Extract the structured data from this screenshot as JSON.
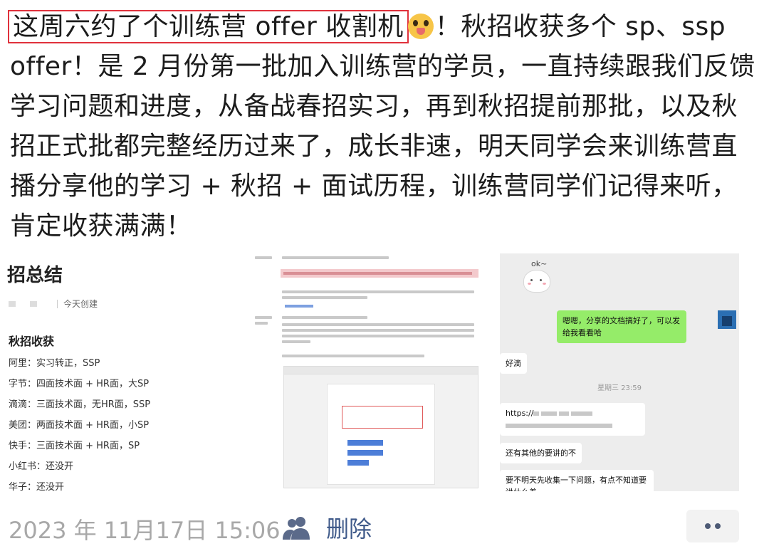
{
  "post": {
    "highlight": "这周六约了个训练营 offer 收割机",
    "text": "！秋招收获多个 sp、ssp offer！是 2 月份第一批加入训练营的学员，一直持续跟我们反馈学习问题和进度，从备战春招实习，再到秋招提前那批，以及秋招正式批都完整经历过来了，成长非速，明天同学会来训练营直播分享他的学习 + 秋招 + 面试历程，训练营同学们记得来听，肯定收获满满！",
    "emoji": "face-with-tongue-emoji"
  },
  "summary": {
    "title": "招总结",
    "created": "今天创建",
    "section": "秋招收获",
    "items": [
      "阿里：实习转正，SSP",
      "字节：四面技术面 + HR面，大SP",
      "滴滴：三面技术面，无HR面，SSP",
      "美团：两面技术面 + HR面，小SP",
      "快手：三面技术面 + HR面，SP",
      "小红书：还没开",
      "华子：还没开"
    ]
  },
  "chat": {
    "sticker_text": "ok~",
    "msg_me": "嗯嗯，分享的文档搞好了，可以发给我看看哈",
    "msg_1": "好滴",
    "time": "星期三 23:59",
    "link_prefix": "https://",
    "msg_2": "还有其他的要讲的不",
    "msg_3": "要不明天先收集一下问题，有点不知道要讲什么着"
  },
  "footer": {
    "date": "2023 年 11月17日 15:06",
    "delete_label": "删除",
    "people_icon": "people-icon",
    "more_icon": "more-icon"
  }
}
